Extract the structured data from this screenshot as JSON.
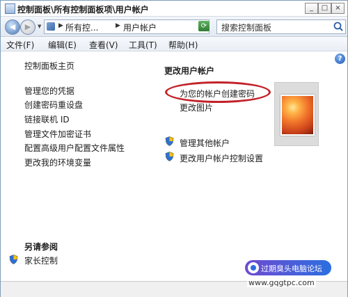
{
  "window": {
    "title": "控制面板\\所有控制面板项\\用户帐户",
    "buttons": {
      "minimize": "_",
      "maximize": "□",
      "close": "×"
    }
  },
  "address": {
    "crumbs": [
      "所有控...",
      "用户帐户"
    ],
    "search_placeholder": "搜索控制面板"
  },
  "menu": [
    "文件(F)",
    "编辑(E)",
    "查看(V)",
    "工具(T)",
    "帮助(H)"
  ],
  "sidebar": {
    "home": "控制面板主页",
    "links": [
      "管理您的凭据",
      "创建密码重设盘",
      "链接联机 ID",
      "管理文件加密证书",
      "配置高级用户配置文件属性",
      "更改我的环境变量"
    ],
    "see_also_heading": "另请参阅",
    "see_also": [
      "家长控制"
    ]
  },
  "main": {
    "heading": "更改用户帐户",
    "tasks": [
      "为您的帐户创建密码",
      "更改图片"
    ],
    "admin_tasks": [
      "管理其他帐户",
      "更改用户帐户控制设置"
    ]
  },
  "watermark": {
    "badge_text": "过期臭头电脑论坛",
    "url": "www.gqgtpc.com"
  },
  "colors": {
    "highlight": "#c22228",
    "accent": "#2b6fe0"
  }
}
